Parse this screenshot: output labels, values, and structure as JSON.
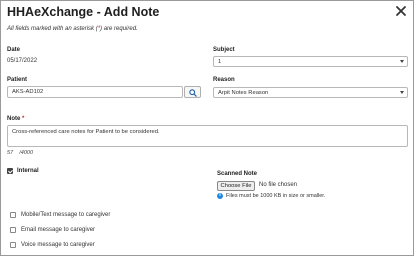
{
  "dialog": {
    "title": "HHAeXchange - Add Note",
    "notice_prefix": "All fields marked with an asterisk (",
    "notice_asterisk": "*",
    "notice_suffix": ") are required."
  },
  "fields": {
    "date_label": "Date",
    "date_value": "05/17/2022",
    "subject_label": "Subject",
    "subject_value": "1",
    "patient_label": "Patient",
    "patient_value": "AKS-AD102",
    "reason_label": "Reason",
    "reason_value": "Arpit Notes Reason",
    "note_label": "Note",
    "note_asterisk": "*",
    "note_value": "Cross-referenced care notes for Patient to be considered.",
    "counter_current": "57",
    "counter_max": "/4000"
  },
  "internal": {
    "label": "Internal",
    "checked": true
  },
  "scanned": {
    "label": "Scanned Note",
    "choose_button": "Choose File",
    "status": "No file chosen",
    "hint": "Files must be 1000 KB in size or smaller."
  },
  "messages": [
    {
      "label": "Mobile/Text message to caregiver",
      "checked": false
    },
    {
      "label": "Email message to caregiver",
      "checked": false
    },
    {
      "label": "Voice message to caregiver",
      "checked": false
    }
  ],
  "icons": {
    "close": "close-icon",
    "search": "search-icon",
    "info": "info-icon",
    "dropdown": "chevron-down-icon"
  },
  "colors": {
    "required": "#c62828",
    "info": "#1e88e5",
    "border": "#9a9a9a"
  }
}
